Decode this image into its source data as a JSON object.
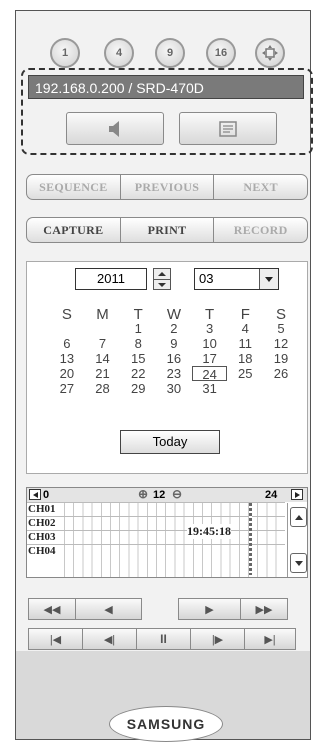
{
  "view_buttons": [
    "1",
    "4",
    "9",
    "16"
  ],
  "device": {
    "address": "192.168.0.200 / SRD-470D"
  },
  "row_seq": {
    "sequence": "SEQUENCE",
    "previous": "PREVIOUS",
    "next": "NEXT"
  },
  "row_cap": {
    "capture": "CAPTURE",
    "print": "PRINT",
    "record": "RECORD"
  },
  "calendar": {
    "year": "2011",
    "month": "03",
    "weekdays": [
      "S",
      "M",
      "T",
      "W",
      "T",
      "F",
      "S"
    ],
    "weeks": [
      [
        "",
        "",
        "1",
        "2",
        "3",
        "4",
        "5"
      ],
      [
        "6",
        "7",
        "8",
        "9",
        "10",
        "11",
        "12"
      ],
      [
        "13",
        "14",
        "15",
        "16",
        "17",
        "18",
        "19"
      ],
      [
        "20",
        "21",
        "22",
        "23",
        "24",
        "25",
        "26"
      ],
      [
        "27",
        "28",
        "29",
        "30",
        "31",
        "",
        ""
      ]
    ],
    "selected_day": "24",
    "today_label": "Today"
  },
  "timeline": {
    "start_hour": "0",
    "mid_hour": "12",
    "end_hour": "24",
    "time": "19:45:18",
    "channels": [
      "CH01",
      "CH02",
      "CH03",
      "CH04"
    ]
  },
  "brand": "SAMSUNG"
}
